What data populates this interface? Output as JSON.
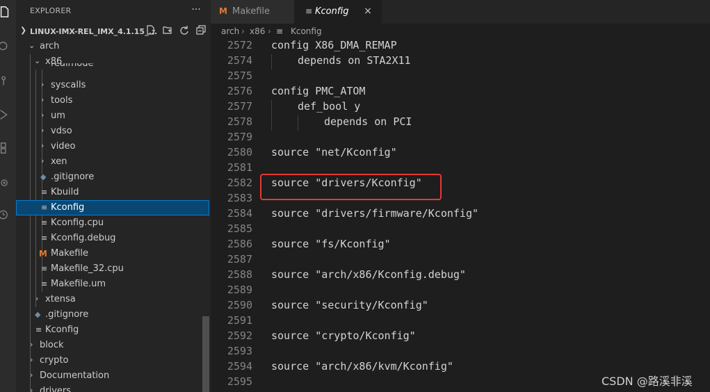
{
  "sidebar": {
    "header": "EXPLORER",
    "more": "···",
    "root_label": "LINUX-IMX-REL_IMX_4.1.15_...",
    "items": [
      {
        "label": "arch",
        "kind": "folder-open",
        "depth": 1
      },
      {
        "label": "x86",
        "kind": "folder-open",
        "depth": 2
      },
      {
        "label": "realmode",
        "kind": "folder",
        "depth": 3
      },
      {
        "label": "syscalls",
        "kind": "folder",
        "depth": 3
      },
      {
        "label": "tools",
        "kind": "folder",
        "depth": 3
      },
      {
        "label": "um",
        "kind": "folder",
        "depth": 3
      },
      {
        "label": "vdso",
        "kind": "folder",
        "depth": 3
      },
      {
        "label": "video",
        "kind": "folder",
        "depth": 3
      },
      {
        "label": "xen",
        "kind": "folder",
        "depth": 3
      },
      {
        "label": ".gitignore",
        "kind": "git",
        "depth": 3
      },
      {
        "label": "Kbuild",
        "kind": "text",
        "depth": 3
      },
      {
        "label": "Kconfig",
        "kind": "text",
        "depth": 3,
        "selected": true
      },
      {
        "label": "Kconfig.cpu",
        "kind": "text",
        "depth": 3
      },
      {
        "label": "Kconfig.debug",
        "kind": "text",
        "depth": 3
      },
      {
        "label": "Makefile",
        "kind": "make",
        "depth": 3
      },
      {
        "label": "Makefile_32.cpu",
        "kind": "text",
        "depth": 3
      },
      {
        "label": "Makefile.um",
        "kind": "text",
        "depth": 3
      },
      {
        "label": "xtensa",
        "kind": "folder",
        "depth": 2
      },
      {
        "label": ".gitignore",
        "kind": "git",
        "depth": 2
      },
      {
        "label": "Kconfig",
        "kind": "text",
        "depth": 2
      },
      {
        "label": "block",
        "kind": "folder",
        "depth": 1
      },
      {
        "label": "crypto",
        "kind": "folder",
        "depth": 1
      },
      {
        "label": "Documentation",
        "kind": "folder",
        "depth": 1
      },
      {
        "label": "drivers",
        "kind": "folder",
        "depth": 1
      }
    ]
  },
  "tabs": [
    {
      "label": "Makefile",
      "icon": "makefile-icon",
      "active": false
    },
    {
      "label": "Kconfig",
      "icon": "text-file-icon",
      "active": true
    }
  ],
  "tab_close": "×",
  "breadcrumb": [
    "arch",
    "x86",
    "Kconfig"
  ],
  "editor": {
    "lines": [
      {
        "n": "2572",
        "code": "config X86_DMA_REMAP",
        "indent": 0
      },
      {
        "n": "2574",
        "code": "depends on STA2X11",
        "indent": 1
      },
      {
        "n": "2575",
        "code": "",
        "indent": 0
      },
      {
        "n": "2576",
        "code": "config PMC_ATOM",
        "indent": 0
      },
      {
        "n": "2577",
        "code": "def_bool y",
        "indent": 1
      },
      {
        "n": "2578",
        "code": "depends on PCI",
        "indent": 2
      },
      {
        "n": "2579",
        "code": "",
        "indent": 0
      },
      {
        "n": "2580",
        "code": "source \"net/Kconfig\"",
        "indent": 0
      },
      {
        "n": "2581",
        "code": "",
        "indent": 0
      },
      {
        "n": "2582",
        "code": "source \"drivers/Kconfig\"",
        "indent": 0
      },
      {
        "n": "2583",
        "code": "",
        "indent": 0
      },
      {
        "n": "2584",
        "code": "source \"drivers/firmware/Kconfig\"",
        "indent": 0
      },
      {
        "n": "2585",
        "code": "",
        "indent": 0
      },
      {
        "n": "2586",
        "code": "source \"fs/Kconfig\"",
        "indent": 0
      },
      {
        "n": "2587",
        "code": "",
        "indent": 0
      },
      {
        "n": "2588",
        "code": "source \"arch/x86/Kconfig.debug\"",
        "indent": 0
      },
      {
        "n": "2589",
        "code": "",
        "indent": 0
      },
      {
        "n": "2590",
        "code": "source \"security/Kconfig\"",
        "indent": 0
      },
      {
        "n": "2591",
        "code": "",
        "indent": 0
      },
      {
        "n": "2592",
        "code": "source \"crypto/Kconfig\"",
        "indent": 0
      },
      {
        "n": "2593",
        "code": "",
        "indent": 0
      },
      {
        "n": "2594",
        "code": "source \"arch/x86/kvm/Kconfig\"",
        "indent": 0
      },
      {
        "n": "2595",
        "code": "",
        "indent": 0
      }
    ]
  },
  "watermark": "CSDN @路溪非溪",
  "colors": {
    "selection": "#094771",
    "highlight_box": "#e53935",
    "makefile_icon": "#e37933",
    "text_icon": "#cccccc",
    "git_icon": "#6a8fa8"
  }
}
